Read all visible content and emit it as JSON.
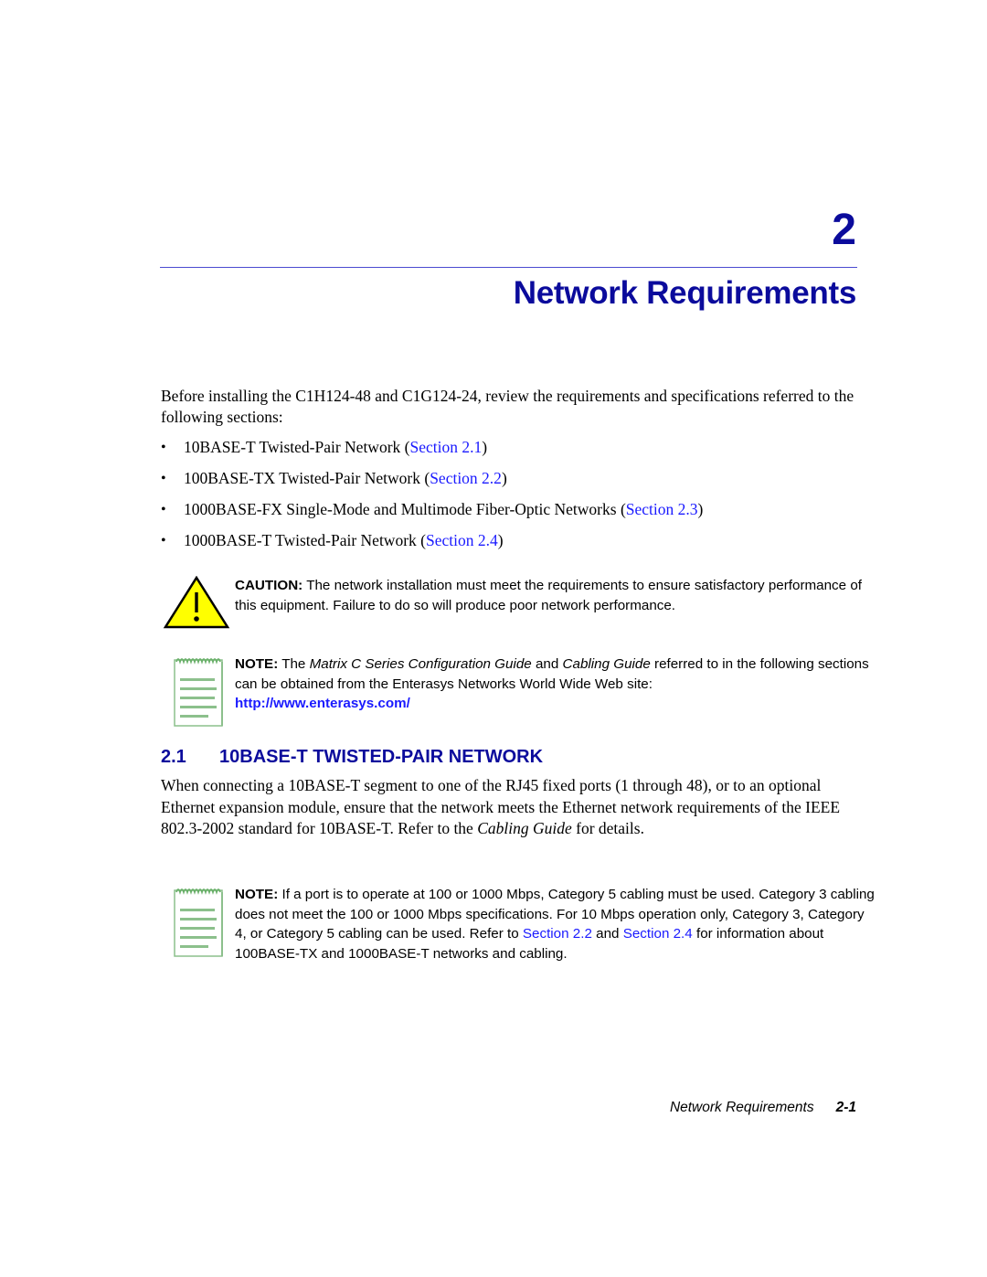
{
  "chapter": {
    "number": "2",
    "title": "Network Requirements"
  },
  "intro": "Before installing the C1H124-48 and C1G124-24, review the requirements and specifications referred to the following sections:",
  "bullets": [
    {
      "text": "10BASE-T Twisted-Pair Network (",
      "link": "Section 2.1",
      "close": ")"
    },
    {
      "text": "100BASE-TX Twisted-Pair Network (",
      "link": "Section 2.2",
      "close": ")"
    },
    {
      "text": "1000BASE-FX Single-Mode and Multimode Fiber-Optic Networks (",
      "link": "Section 2.3",
      "close": ")"
    },
    {
      "text": "1000BASE-T Twisted-Pair Network (",
      "link": "Section 2.4",
      "close": ")"
    }
  ],
  "caution": {
    "label": "CAUTION:",
    "text": "The network installation must meet the requirements to ensure satisfactory performance of this equipment. Failure to do so will produce poor network performance.",
    "icon": "warning-triangle-icon"
  },
  "note1": {
    "label": "NOTE:",
    "pre": "The",
    "guide1": "Matrix C Series Configuration Guide",
    "mid": "and",
    "guide2": "Cabling Guide",
    "post": "referred to in the following sections can be obtained from the Enterasys Networks World Wide Web site:",
    "url": "http://www.enterasys.com/",
    "icon": "notepad-icon"
  },
  "section": {
    "number": "2.1",
    "title": "10BASE-T TWISTED-PAIR NETWORK",
    "body_pre": "When connecting a 10BASE-T segment to one of the RJ45 fixed ports (1 through 48), or to an optional Ethernet expansion module, ensure that the network meets the Ethernet network requirements of the IEEE 802.3-2002 standard for 10BASE-T. Refer to the",
    "body_italic": "Cabling Guide",
    "body_post": "for details."
  },
  "note2": {
    "label": "NOTE:",
    "text": "If a port is to operate at 100 or 1000 Mbps, Category 5 cabling must be used. Category 3 cabling does not meet the 100 or 1000 Mbps specifications. For 10 Mbps operation only, Category 3, Category 4, or Category 5 cabling can be used. Refer to",
    "link1": "Section 2.2",
    "mid": "and",
    "link2": "Section 2.4",
    "post": "for information about 100BASE-TX and 1000BASE-T networks and cabling.",
    "icon": "notepad-icon"
  },
  "footer": {
    "title": "Network Requirements",
    "page": "2-1"
  },
  "colors": {
    "heading_blue": "#0b0b9c",
    "link_blue": "#1a1aff",
    "caution_yellow": "#ffff00",
    "note_green": "#7fbf7f"
  }
}
